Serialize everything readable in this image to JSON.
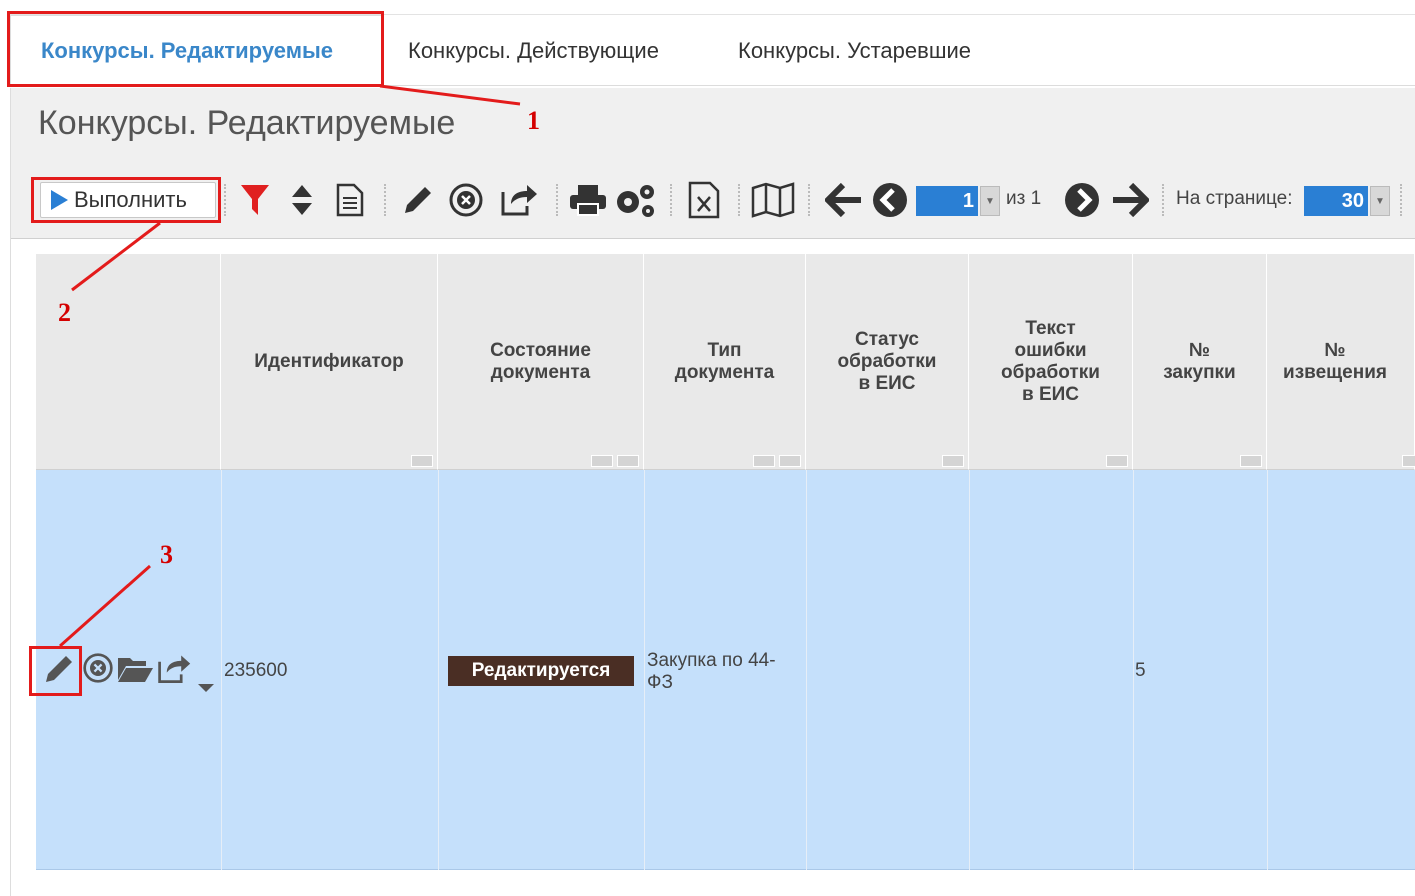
{
  "tabs": [
    {
      "label": "Конкурсы. Редактируемые",
      "active": true
    },
    {
      "label": "Конкурсы. Действующие",
      "active": false
    },
    {
      "label": "Конкурсы. Устаревшие",
      "active": false
    }
  ],
  "page_title": "Конкурсы. Редактируемые",
  "toolbar": {
    "run_label": "Выполнить",
    "page_current": "1",
    "page_of": "из 1",
    "per_page_label": "На странице:",
    "per_page_value": "30",
    "icons": [
      "filter-icon",
      "sort-icon",
      "document-icon",
      "edit-icon",
      "delete-icon",
      "share-icon",
      "print-icon",
      "settings-icon",
      "excel-icon",
      "map-icon",
      "first-page-icon",
      "prev-page-icon",
      "next-page-icon",
      "last-page-icon"
    ]
  },
  "table": {
    "columns": [
      "",
      "Идентификатор",
      "Состояние документа",
      "Тип документа",
      "Статус обработки в ЕИС",
      "Текст ошибки обработки в ЕИС",
      "№ закупки",
      "№ извещения"
    ],
    "rows": [
      {
        "id": "235600",
        "state": "Редактируется",
        "type": "Закупка по 44-ФЗ",
        "eis_status": "",
        "eis_error": "",
        "purchase_no": "5",
        "notice_no": ""
      }
    ]
  },
  "annotations": [
    "1",
    "2",
    "3"
  ],
  "colors": {
    "accent": "#2a7fd4",
    "tab_active": "#3a87c9",
    "annotation": "#e31b1b",
    "row_selected": "#c5e0fb",
    "badge": "#4a2e24"
  }
}
